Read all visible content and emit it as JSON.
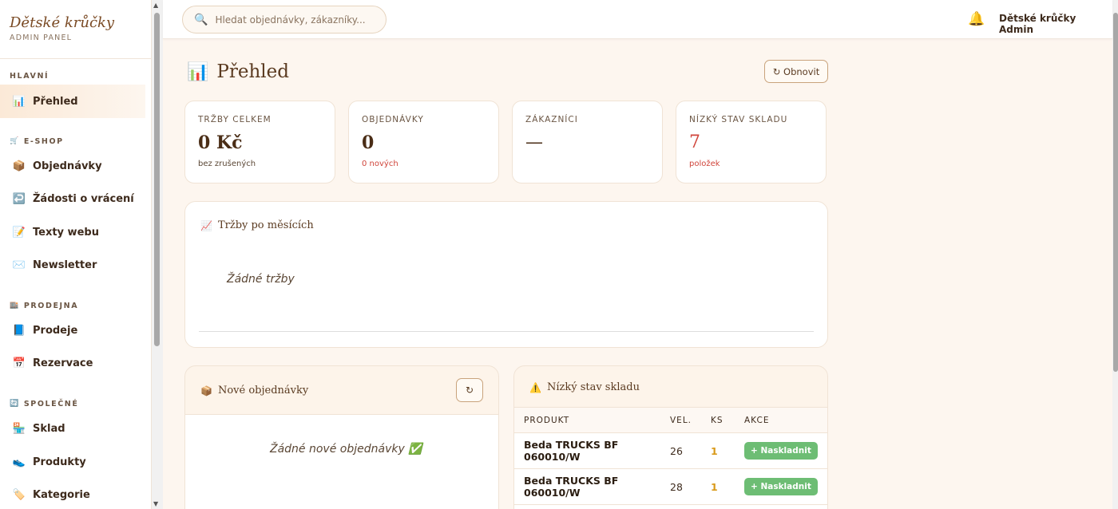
{
  "brand": {
    "title": "Dětské krůčky",
    "subtitle": "ADMIN PANEL"
  },
  "sidebar": {
    "sections": [
      {
        "label": "HLAVNÍ",
        "icon": ""
      },
      {
        "label": "E-SHOP",
        "icon": "🛒"
      },
      {
        "label": "PRODEJNA",
        "icon": "🏬"
      },
      {
        "label": "SPOLEČNÉ",
        "icon": "🔄"
      }
    ],
    "items": [
      {
        "label": "Přehled",
        "icon": "📊"
      },
      {
        "label": "Objednávky",
        "icon": "📦"
      },
      {
        "label": "Žádosti o vrácení",
        "icon": "↩️"
      },
      {
        "label": "Texty webu",
        "icon": "📝"
      },
      {
        "label": "Newsletter",
        "icon": "✉️"
      },
      {
        "label": "Prodeje",
        "icon": "📘"
      },
      {
        "label": "Rezervace",
        "icon": "📅"
      },
      {
        "label": "Sklad",
        "icon": "🏪"
      },
      {
        "label": "Produkty",
        "icon": "👟"
      },
      {
        "label": "Kategorie",
        "icon": "🏷️"
      }
    ],
    "active_item": "Přehled"
  },
  "topbar": {
    "search_placeholder": "Hledat objednávky, zákazníky...",
    "user_name": "Dětské krůčky Admin"
  },
  "page": {
    "title": "Přehled",
    "title_icon": "📊",
    "refresh_label": "↻ Obnovit"
  },
  "stats": [
    {
      "label": "TRŽBY CELKEM",
      "value": "0 Kč",
      "sub": "bez zrušených"
    },
    {
      "label": "OBJEDNÁVKY",
      "value": "0",
      "sub": "0 nových"
    },
    {
      "label": "ZÁKAZNÍCI",
      "value": "—",
      "sub": ""
    },
    {
      "label": "NÍZKÝ STAV SKLADU",
      "value": "7",
      "sub": "položek"
    }
  ],
  "revenue_card": {
    "title": "Tržby po měsících",
    "icon": "📈",
    "empty": "Žádné tržby"
  },
  "orders_card": {
    "title": "Nové objednávky",
    "icon": "📦",
    "empty": "Žádné nové objednávky ✅",
    "refresh": "↻"
  },
  "low_stock_card": {
    "title": "Nízký stav skladu",
    "icon": "⚠️",
    "columns": [
      "PRODUKT",
      "VEL.",
      "KS",
      "AKCE"
    ],
    "rows": [
      {
        "product": "Beda TRUCKS BF 060010/W",
        "size": "26",
        "qty": "1",
        "action": "+ Naskladnit"
      },
      {
        "product": "Beda TRUCKS BF 060010/W",
        "size": "28",
        "qty": "1",
        "action": "+ Naskladnit"
      }
    ]
  },
  "colors": {
    "accent": "#5a3a20",
    "warning": "#d0453b",
    "success": "#6dbd74",
    "background": "#fdf6ef"
  }
}
